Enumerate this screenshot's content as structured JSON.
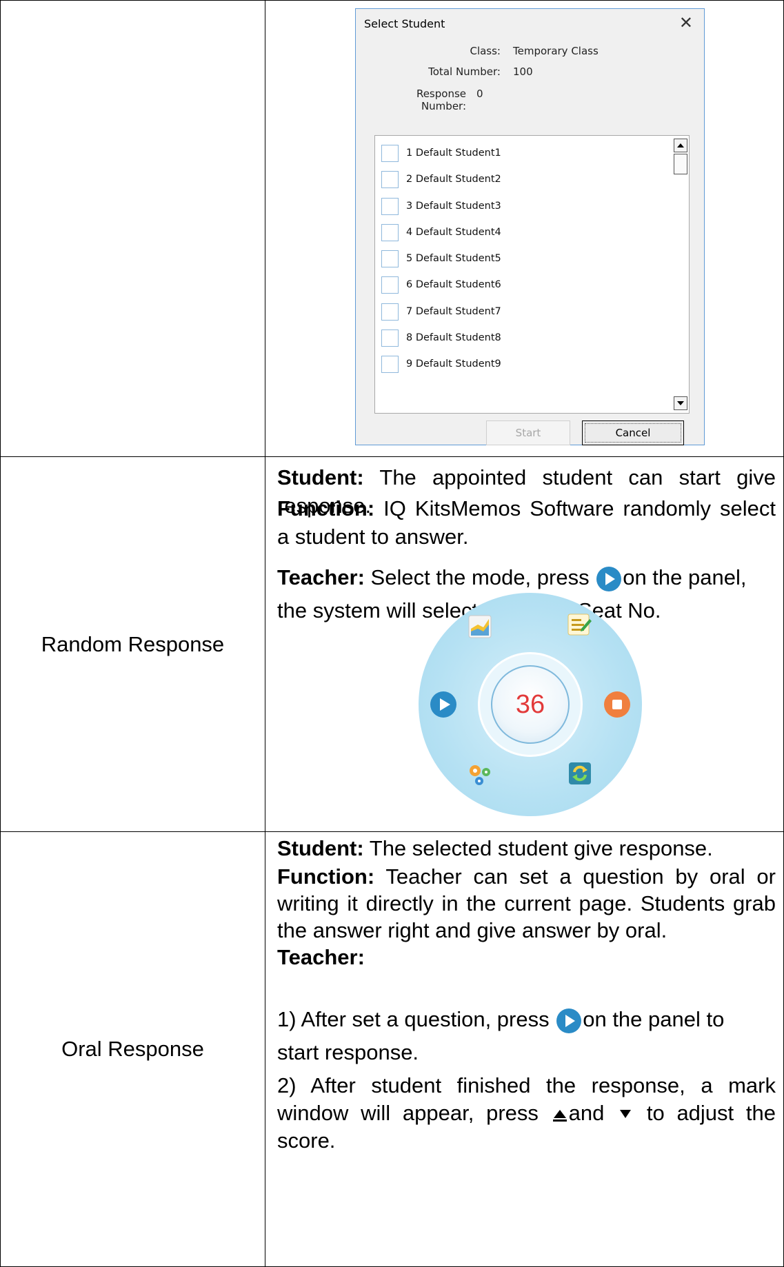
{
  "dialog": {
    "title": "Select Student",
    "close_glyph": "✕",
    "class_label": "Class:",
    "class_value": "Temporary Class",
    "total_label": "Total Number:",
    "total_value": "100",
    "response_label": "Response Number:",
    "response_value": "0",
    "students": [
      "1 Default Student1",
      "2 Default Student2",
      "3 Default Student3",
      "4 Default Student4",
      "5 Default Student5",
      "6 Default Student6",
      "7 Default Student7",
      "8 Default Student8",
      "9 Default Student9"
    ],
    "start_label": "Start",
    "cancel_label": "Cancel"
  },
  "section1": {
    "student_heading": "Student:",
    "student_text": " The appointed student can start give response."
  },
  "random": {
    "label": "Random Response",
    "function_heading": "Function:",
    "function_text": " IQ KitsMemos Software randomly select a student to answer.",
    "teacher_heading": "Teacher:",
    "teacher_text_a": " Select the mode, press ",
    "teacher_text_b": "on the panel,",
    "teacher_text_c": "the system will select a student Seat No.",
    "wheel_number": "36",
    "student_heading": "Student:",
    "student_text": " The selected student give response."
  },
  "oral": {
    "label": "Oral Response",
    "function_heading": "Function:",
    "function_text": " Teacher can set a question by oral or writing it directly in the current page. Students grab the answer right and give answer by oral.",
    "teacher_heading": "Teacher:",
    "step1_a": "1) After set a question, press ",
    "step1_b": "on the panel to",
    "step1_c": "start response.",
    "step2_a": "2) After student finished the response, a mark window will appear, press ",
    "step2_b": "and ",
    "step2_c": " to adjust the score."
  },
  "colors": {
    "play_icon": "#2a8bc6",
    "stop_icon": "#f07f3e",
    "wheel_number": "#e23a3a"
  }
}
